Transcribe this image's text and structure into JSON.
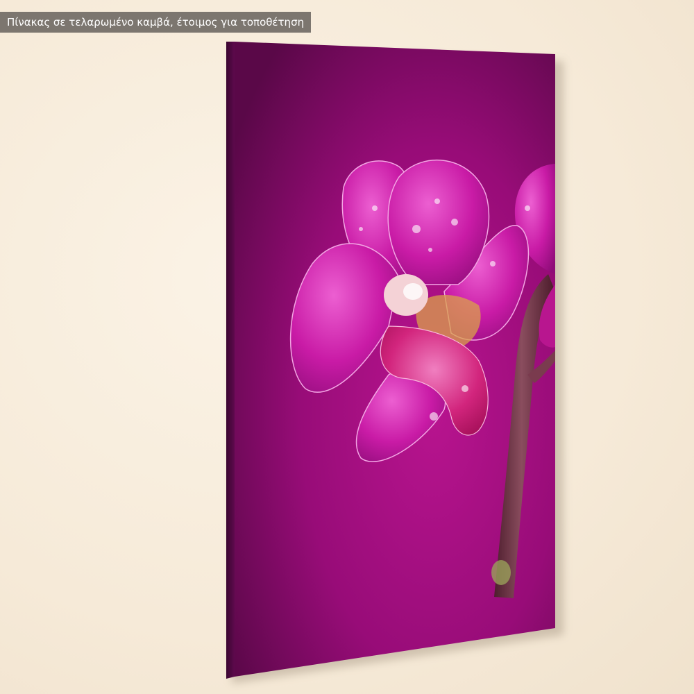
{
  "caption": {
    "text": "Πίνακας σε τελαρωμένο καμβά,  έτοιμος για τοποθέτηση"
  },
  "colors": {
    "wall": "#f6ead8",
    "caption_bg": "#7c766f",
    "canvas_purple": "#9a0f7d",
    "canvas_edge": "#52083f",
    "orchid_petal": "#c21aa0",
    "stem": "#7a3b4e"
  }
}
